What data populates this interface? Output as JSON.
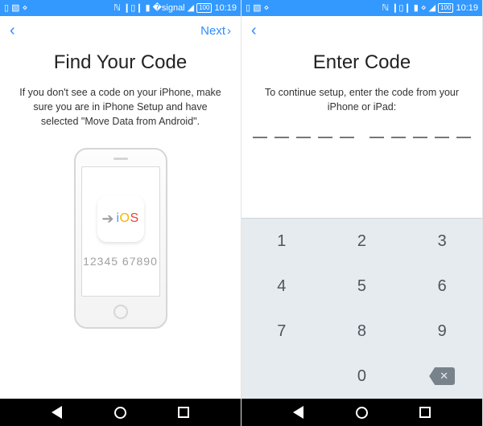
{
  "status": {
    "time": "10:19",
    "battery": "100"
  },
  "screen1": {
    "nav": {
      "back": "‹",
      "next": "Next",
      "next_chevron": "›"
    },
    "title": "Find Your Code",
    "subtitle": "If you don't see a code on your iPhone, make sure you are in iPhone Setup and have selected \"Move Data from Android\".",
    "phone": {
      "ios_label": "iOS",
      "sample_code": "12345 67890"
    }
  },
  "screen2": {
    "nav": {
      "back": "‹"
    },
    "title": "Enter Code",
    "subtitle": "To continue setup, enter the code from your iPhone or iPad:",
    "code_length": 10,
    "keypad": {
      "r1": [
        "1",
        "2",
        "3"
      ],
      "r2": [
        "4",
        "5",
        "6"
      ],
      "r3": [
        "7",
        "8",
        "9"
      ],
      "r4_left": "",
      "r4_mid": "0",
      "r4_right": "⌫"
    }
  }
}
